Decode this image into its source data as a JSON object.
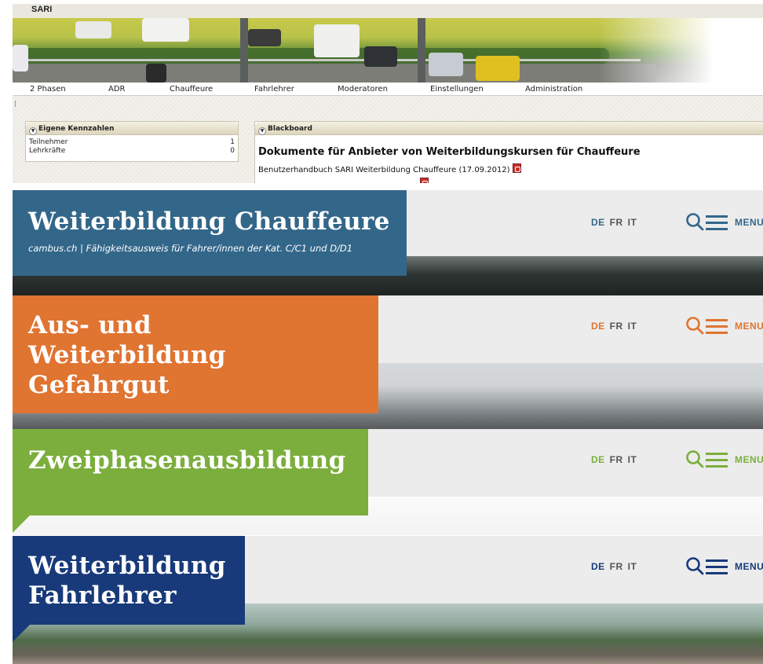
{
  "sari": {
    "title": "SARI",
    "nav": [
      "2 Phasen",
      "ADR",
      "Chauffeure",
      "Fahrlehrer",
      "Moderatoren",
      "Einstellungen",
      "Administration"
    ],
    "kennzahlen": {
      "title": "Eigene Kennzahlen",
      "rows": [
        {
          "label": "Teilnehmer",
          "value": "1"
        },
        {
          "label": "Lehrkräfte",
          "value": "0"
        }
      ]
    },
    "blackboard": {
      "title": "Blackboard",
      "heading": "Dokumente für Anbieter von Weiterbildungskursen für Chauffeure",
      "line1": "Benutzerhandbuch SARI Weiterbildung Chauffeure (17.09.2012)",
      "line2": "                                                                "
    }
  },
  "panels": {
    "chauffeure": {
      "title": "Weiterbildung Chauffeure",
      "subtitle": "cambus.ch | Fähigkeitsausweis für Fahrer/innen der Kat. C/C1 und D/D1",
      "accent": "#33678a"
    },
    "gefahrgut": {
      "title_lines": [
        "Aus- und",
        "Weiterbildung",
        "Gefahrgut"
      ],
      "accent": "#e07431"
    },
    "zweiphasen": {
      "title": "Zweiphasenausbildung",
      "accent": "#7bae3d"
    },
    "fahrlehrer": {
      "title_lines": [
        "Weiterbildung",
        "Fahrlehrer"
      ],
      "accent": "#183a7a"
    }
  },
  "lang": {
    "de": "DE",
    "fr": "FR",
    "it": "IT"
  },
  "menu_label": "MENU",
  "menu_label_cut": "MENU",
  "icons": {
    "search": "search-icon",
    "menu": "hamburger-icon",
    "pdf": "pdf-icon",
    "toggle": "collapse-toggle-icon"
  }
}
